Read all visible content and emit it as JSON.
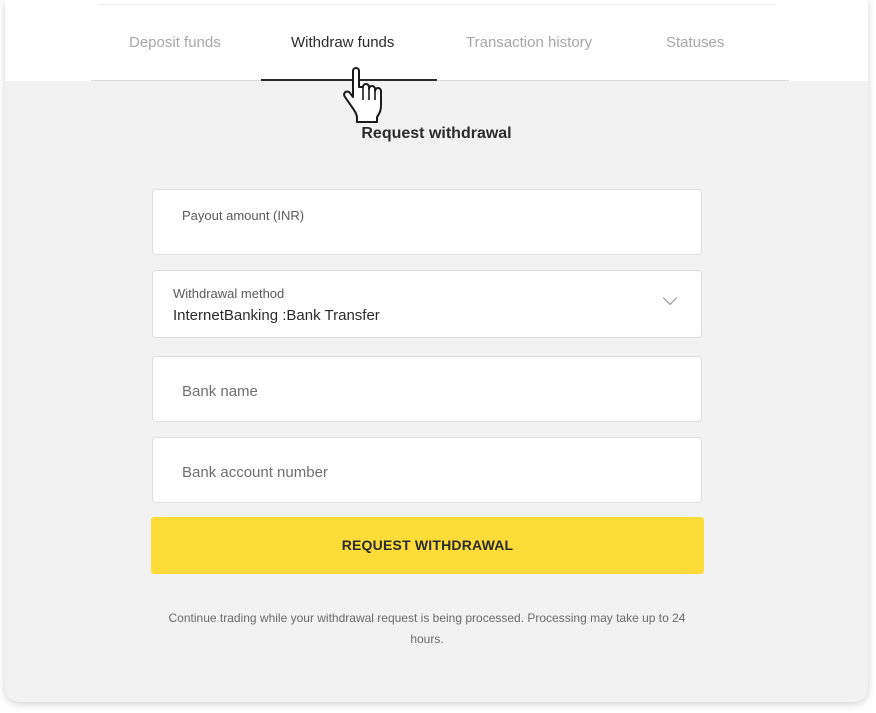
{
  "tabs": [
    {
      "label": "Deposit funds",
      "active": false
    },
    {
      "label": "Withdraw funds",
      "active": true
    },
    {
      "label": "Transaction history",
      "active": false
    },
    {
      "label": "Statuses",
      "active": false
    }
  ],
  "form": {
    "title": "Request withdrawal",
    "payout_amount": {
      "label": "Payout amount (INR)",
      "value": ""
    },
    "withdrawal_method": {
      "label": "Withdrawal method",
      "value": "InternetBanking :Bank Transfer",
      "icon": "chevron-down-icon"
    },
    "bank_name": {
      "placeholder": "Bank name",
      "value": ""
    },
    "bank_account_number": {
      "placeholder": "Bank account number",
      "value": ""
    },
    "submit_label": "REQUEST WITHDRAWAL",
    "note": "Continue trading while your withdrawal request is being processed.  Processing may take up to 24 hours."
  },
  "colors": {
    "accent": "#fddc3a",
    "background": "#f2f2f2",
    "text": "#2b2b2b",
    "muted_text": "#a7a7a7"
  },
  "cursor": {
    "icon": "hand-pointer-cursor-icon"
  }
}
